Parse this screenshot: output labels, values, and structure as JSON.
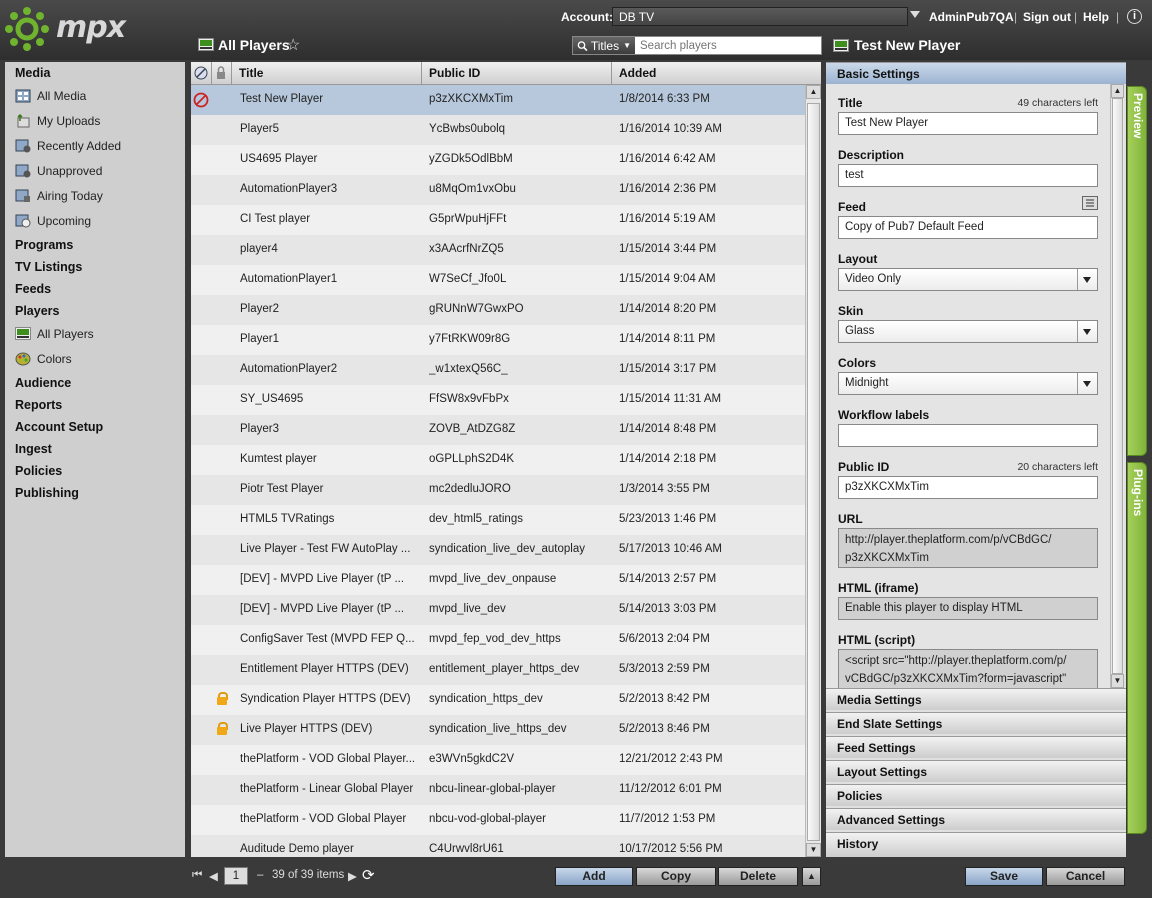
{
  "app": {
    "logo_text": "mpx"
  },
  "header": {
    "account_label": "Account:",
    "account_value": "DB TV",
    "user": "AdminPub7QA",
    "sign_out": "Sign out",
    "help": "Help",
    "info_icon": "info-icon"
  },
  "nav": {
    "media": "Media",
    "all_media": "All Media",
    "my_uploads": "My Uploads",
    "recently_added": "Recently Added",
    "unapproved": "Unapproved",
    "airing_today": "Airing Today",
    "upcoming": "Upcoming",
    "programs": "Programs",
    "tv_listings": "TV Listings",
    "feeds": "Feeds",
    "players": "Players",
    "all_players": "All Players",
    "colors": "Colors",
    "audience": "Audience",
    "reports": "Reports",
    "account_setup": "Account Setup",
    "ingest": "Ingest",
    "policies": "Policies",
    "publishing": "Publishing"
  },
  "list": {
    "title": "All Players",
    "search_scope": "Titles",
    "search_placeholder": "Search players",
    "columns": {
      "title": "Title",
      "public_id": "Public ID",
      "added": "Added"
    },
    "rows": [
      {
        "title": "Test New Player",
        "id": "p3zXKCXMxTim",
        "added": "1/8/2014 6:33 PM",
        "status": "disabled",
        "locked": false
      },
      {
        "title": "Player5",
        "id": "YcBwbs0ubolq",
        "added": "1/16/2014 10:39 AM",
        "status": "",
        "locked": false
      },
      {
        "title": "US4695 Player",
        "id": "yZGDk5OdlBbM",
        "added": "1/16/2014 6:42 AM",
        "status": "",
        "locked": false
      },
      {
        "title": "AutomationPlayer3",
        "id": "u8MqOm1vxObu",
        "added": "1/16/2014 2:36 PM",
        "status": "",
        "locked": false
      },
      {
        "title": "CI Test player",
        "id": "G5prWpuHjFFt",
        "added": "1/16/2014 5:19 AM",
        "status": "",
        "locked": false
      },
      {
        "title": "player4",
        "id": "x3AAcrfNrZQ5",
        "added": "1/15/2014 3:44 PM",
        "status": "",
        "locked": false
      },
      {
        "title": "AutomationPlayer1",
        "id": "W7SeCf_Jfo0L",
        "added": "1/15/2014 9:04 AM",
        "status": "",
        "locked": false
      },
      {
        "title": "Player2",
        "id": "gRUNnW7GwxPO",
        "added": "1/14/2014 8:20 PM",
        "status": "",
        "locked": false
      },
      {
        "title": "Player1",
        "id": "y7FtRKW09r8G",
        "added": "1/14/2014 8:11 PM",
        "status": "",
        "locked": false
      },
      {
        "title": "AutomationPlayer2",
        "id": "_w1xtexQ56C_",
        "added": "1/15/2014 3:17 PM",
        "status": "",
        "locked": false
      },
      {
        "title": "SY_US4695",
        "id": "FfSW8x9vFbPx",
        "added": "1/15/2014 11:31 AM",
        "status": "",
        "locked": false
      },
      {
        "title": "Player3",
        "id": "ZOVB_AtDZG8Z",
        "added": "1/14/2014 8:48 PM",
        "status": "",
        "locked": false
      },
      {
        "title": "Kumtest player",
        "id": "oGPLLphS2D4K",
        "added": "1/14/2014 2:18 PM",
        "status": "",
        "locked": false
      },
      {
        "title": "Piotr Test Player",
        "id": "mc2dedluJORO",
        "added": "1/3/2014 3:55 PM",
        "status": "",
        "locked": false
      },
      {
        "title": "HTML5 TVRatings",
        "id": "dev_html5_ratings",
        "added": "5/23/2013 1:46 PM",
        "status": "",
        "locked": false
      },
      {
        "title": "Live Player - Test FW AutoPlay ...",
        "id": "syndication_live_dev_autoplay",
        "added": "5/17/2013 10:46 AM",
        "status": "",
        "locked": false
      },
      {
        "title": "[DEV] - MVPD Live Player (tP ...",
        "id": "mvpd_live_dev_onpause",
        "added": "5/14/2013 2:57 PM",
        "status": "",
        "locked": false
      },
      {
        "title": "[DEV] - MVPD Live Player (tP ...",
        "id": "mvpd_live_dev",
        "added": "5/14/2013 3:03 PM",
        "status": "",
        "locked": false
      },
      {
        "title": "ConfigSaver Test (MVPD FEP Q...",
        "id": "mvpd_fep_vod_dev_https",
        "added": "5/6/2013 2:04 PM",
        "status": "",
        "locked": false
      },
      {
        "title": "Entitlement Player HTTPS (DEV)",
        "id": "entitlement_player_https_dev",
        "added": "5/3/2013 2:59 PM",
        "status": "",
        "locked": false
      },
      {
        "title": "Syndication Player HTTPS (DEV)",
        "id": "syndication_https_dev",
        "added": "5/2/2013 8:42 PM",
        "status": "",
        "locked": true
      },
      {
        "title": "Live Player HTTPS (DEV)",
        "id": "syndication_live_https_dev",
        "added": "5/2/2013 8:46 PM",
        "status": "",
        "locked": true
      },
      {
        "title": "thePlatform - VOD Global Player...",
        "id": "e3WVn5gkdC2V",
        "added": "12/21/2012 2:43 PM",
        "status": "",
        "locked": false
      },
      {
        "title": "thePlatform - Linear Global Player",
        "id": "nbcu-linear-global-player",
        "added": "11/12/2012 6:01 PM",
        "status": "",
        "locked": false
      },
      {
        "title": "thePlatform - VOD Global Player",
        "id": "nbcu-vod-global-player",
        "added": "11/7/2012 1:53 PM",
        "status": "",
        "locked": false
      },
      {
        "title": "Auditude Demo player",
        "id": "C4Urwvl8rU61",
        "added": "10/17/2012 5:56 PM",
        "status": "",
        "locked": false
      }
    ]
  },
  "pager": {
    "page": "1",
    "dash": "–",
    "summary": "39 of 39 items"
  },
  "actions": {
    "add": "Add",
    "copy": "Copy",
    "delete": "Delete"
  },
  "editor": {
    "title": "Test New Player",
    "sections": {
      "basic": "Basic Settings",
      "media": "Media Settings",
      "end_slate": "End Slate Settings",
      "feed": "Feed Settings",
      "layout": "Layout Settings",
      "policies": "Policies",
      "advanced": "Advanced Settings",
      "history": "History"
    },
    "fields": {
      "title_label": "Title",
      "title_count": "49 characters left",
      "title_value": "Test New Player",
      "description_label": "Description",
      "description_value": "test",
      "feed_label": "Feed",
      "feed_value": "Copy of Pub7 Default Feed",
      "layout_label": "Layout",
      "layout_value": "Video Only",
      "skin_label": "Skin",
      "skin_value": "Glass",
      "colors_label": "Colors",
      "colors_value": "Midnight",
      "workflow_label": "Workflow labels",
      "workflow_value": "",
      "public_id_label": "Public ID",
      "public_id_count": "20 characters left",
      "public_id_value": "p3zXKCXMxTim",
      "url_label": "URL",
      "url_line1": "http://player.theplatform.com/p/vCBdGC/",
      "url_line2": "p3zXKCXMxTim",
      "html_iframe_label": "HTML (iframe)",
      "html_iframe_value": "Enable this player to display HTML",
      "html_script_label": "HTML (script)",
      "html_script_line1": "<script src=\"http://player.theplatform.com/p/",
      "html_script_line2": "vCBdGC/p3zXKCXMxTim?form=javascript\""
    },
    "side_tabs": {
      "preview": "Preview",
      "plugins": "Plug-ins"
    },
    "save": "Save",
    "cancel": "Cancel"
  }
}
